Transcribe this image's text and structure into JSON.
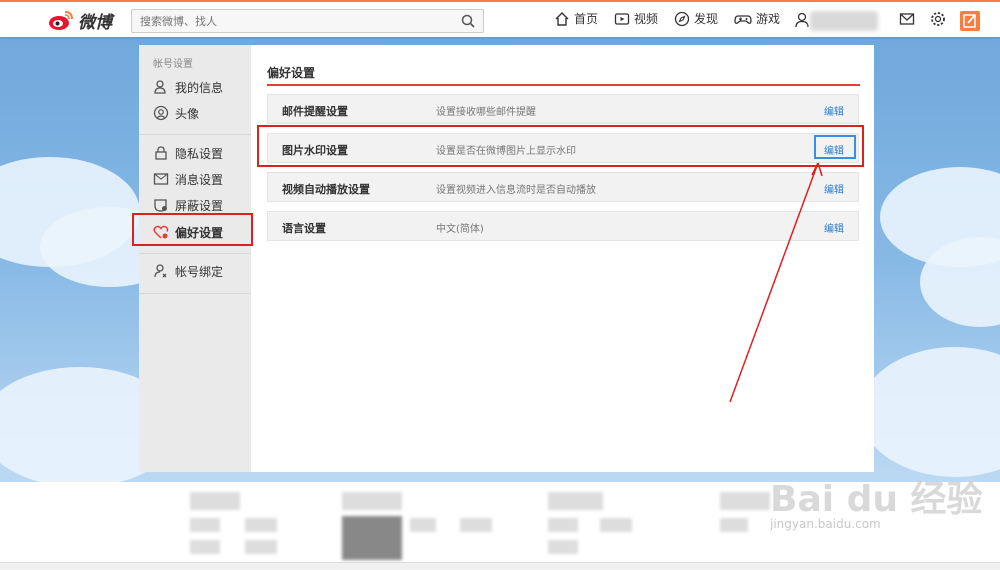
{
  "brand": {
    "name": "微博",
    "accent": "#fa7d3c"
  },
  "search": {
    "placeholder": "搜索微博、找人"
  },
  "nav": {
    "home": "首页",
    "video": "视频",
    "discover": "发现",
    "game": "游戏"
  },
  "sidebar": {
    "section_title": "帐号设置",
    "items": [
      {
        "label": "我的信息",
        "icon": "user-icon"
      },
      {
        "label": "头像",
        "icon": "avatar-icon"
      },
      {
        "label": "隐私设置",
        "icon": "lock-icon"
      },
      {
        "label": "消息设置",
        "icon": "message-icon"
      },
      {
        "label": "屏蔽设置",
        "icon": "shield-icon"
      },
      {
        "label": "偏好设置",
        "icon": "heart-gear-icon",
        "active": true
      },
      {
        "label": "帐号绑定",
        "icon": "user-link-icon"
      }
    ]
  },
  "main": {
    "title": "偏好设置",
    "rows": [
      {
        "label": "邮件提醒设置",
        "desc": "设置接收哪些邮件提醒",
        "action": "编辑"
      },
      {
        "label": "图片水印设置",
        "desc": "设置是否在微博图片上显示水印",
        "action": "编辑"
      },
      {
        "label": "视频自动播放设置",
        "desc": "设置视频进入信息流时是否自动播放",
        "action": "编辑"
      },
      {
        "label": "语言设置",
        "desc": "中文(简体)",
        "action": "编辑"
      }
    ]
  },
  "watermark": {
    "logo": "Bai du 经验",
    "url": "jingyan.baidu.com"
  },
  "annotation_color": "#e02020"
}
